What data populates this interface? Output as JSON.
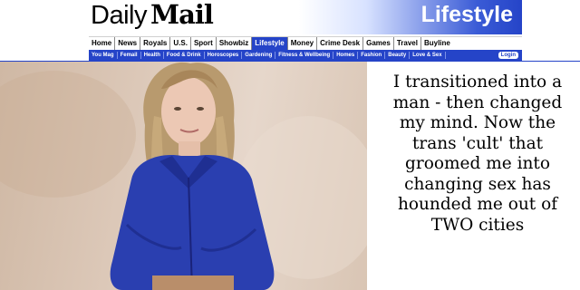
{
  "masthead": {
    "logo_daily": "Daily",
    "logo_mail": "Mail",
    "channel": "Lifestyle"
  },
  "nav": {
    "primary": [
      "Home",
      "News",
      "Royals",
      "U.S.",
      "Sport",
      "Showbiz",
      "Lifestyle",
      "Money",
      "Crime Desk",
      "Games",
      "Travel",
      "Buyline"
    ],
    "active": "Lifestyle",
    "secondary": [
      "You Mag",
      "Femail",
      "Health",
      "Food & Drink",
      "Horoscopes",
      "Gardening",
      "Fitness & Wellbeing",
      "Homes",
      "Fashion",
      "Beauty",
      "Love & Sex"
    ],
    "login_label": "Login"
  },
  "article": {
    "headline": "I transitioned into a man - then changed my mind. Now the trans 'cult' that groomed me into changing sex has hounded me out of TWO cities"
  },
  "colors": {
    "brand_blue": "#2544c8",
    "jacket_blue": "#2a3fb0"
  }
}
